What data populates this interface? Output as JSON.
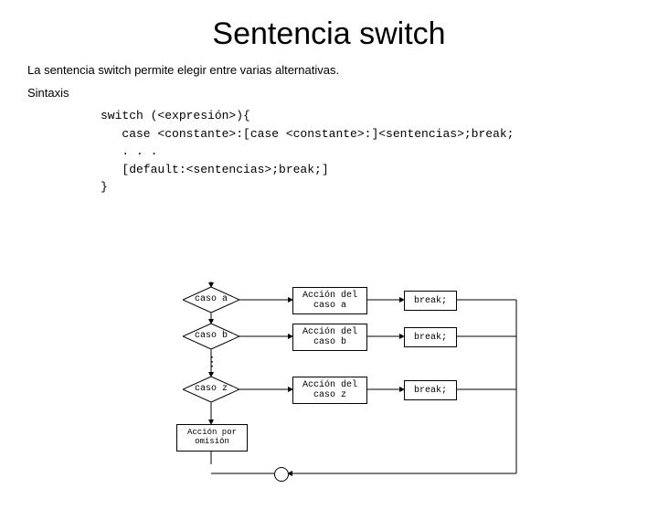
{
  "title": "Sentencia switch",
  "intro": "La sentencia switch permite elegir entre varias alternativas.",
  "sintaxis_label": "Sintaxis",
  "code": {
    "l1": "switch (<expresión>){",
    "l2": "   case <constante>:[case <constante>:]<sentencias>;break;",
    "l3": "   . . .",
    "l4": "   [default:<sentencias>;break;]",
    "l5": "}"
  },
  "diagram": {
    "caso_a": "caso a",
    "caso_b": "caso b",
    "caso_z": "caso z",
    "accion_a": "Acción del\ncaso a",
    "accion_b": "Acción del\ncaso b",
    "accion_z": "Acción del\ncaso z",
    "break": "break;",
    "default": "Acción por\nomisión"
  }
}
